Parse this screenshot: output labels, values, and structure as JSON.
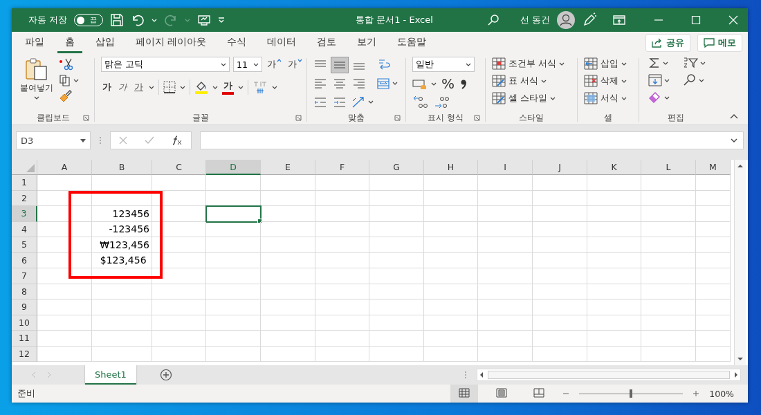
{
  "title_bar": {
    "autosave_label": "자동 저장",
    "autosave_toggle": {
      "label": "끔",
      "on": false
    },
    "redo_disabled": true,
    "document_title": "통합 문서1  -  Excel",
    "user_name": "선 동건"
  },
  "ribbon_tabs": [
    {
      "label": "파일",
      "selected": false
    },
    {
      "label": "홈",
      "selected": true
    },
    {
      "label": "삽입",
      "selected": false
    },
    {
      "label": "페이지 레이아웃",
      "selected": false
    },
    {
      "label": "수식",
      "selected": false
    },
    {
      "label": "데이터",
      "selected": false
    },
    {
      "label": "검토",
      "selected": false
    },
    {
      "label": "보기",
      "selected": false
    },
    {
      "label": "도움말",
      "selected": false
    }
  ],
  "share_button": "공유",
  "comments_button": "메모",
  "clipboard": {
    "paste": "붙여넣기",
    "label": "클립보드"
  },
  "font": {
    "font_name": "맑은 고딕",
    "font_size": "11",
    "grow": "가",
    "shrink": "가",
    "bold": "가",
    "italic": "가",
    "underline": "가",
    "font_color": "가",
    "label": "글꼴"
  },
  "alignment": {
    "vertical_align": [
      {
        "selected": false
      },
      {
        "selected": true
      },
      {
        "selected": false
      }
    ],
    "label": "맞춤"
  },
  "number": {
    "format": "일반",
    "percent": "%",
    "label": "표시 형식"
  },
  "styles": {
    "items": [
      "조건부 서식",
      "표 서식",
      "셀 스타일"
    ],
    "label": "스타일"
  },
  "cells": {
    "items": [
      "삽입",
      "삭제",
      "서식"
    ],
    "label": "셀"
  },
  "editing": {
    "label": "편집"
  },
  "formula_bar": {
    "name_box": "D3"
  },
  "columns": [
    {
      "label": "A",
      "selected": false
    },
    {
      "label": "B",
      "selected": false
    },
    {
      "label": "C",
      "selected": false
    },
    {
      "label": "D",
      "selected": true
    },
    {
      "label": "E",
      "selected": false
    },
    {
      "label": "F",
      "selected": false
    },
    {
      "label": "G",
      "selected": false
    },
    {
      "label": "H",
      "selected": false
    },
    {
      "label": "I",
      "selected": false
    },
    {
      "label": "J",
      "selected": false
    },
    {
      "label": "K",
      "selected": false
    },
    {
      "label": "L",
      "selected": false
    },
    {
      "label": "M",
      "selected": false
    }
  ],
  "rows": [
    {
      "label": "1",
      "selected": false
    },
    {
      "label": "2",
      "selected": false
    },
    {
      "label": "3",
      "selected": true,
      "cells": [
        null,
        "123456"
      ]
    },
    {
      "label": "4",
      "selected": false,
      "cells": [
        null,
        "-123456"
      ]
    },
    {
      "label": "5",
      "selected": false,
      "cells": [
        null,
        "₩123,456"
      ]
    },
    {
      "label": "6",
      "selected": false,
      "cells": [
        null,
        "$123,456 "
      ]
    },
    {
      "label": "7",
      "selected": false
    },
    {
      "label": "8",
      "selected": false
    },
    {
      "label": "9",
      "selected": false
    },
    {
      "label": "10",
      "selected": false
    },
    {
      "label": "11",
      "selected": false
    },
    {
      "label": "12",
      "selected": false
    }
  ],
  "sheet_tabs": [
    {
      "label": "Sheet1",
      "selected": true
    }
  ],
  "status_bar": {
    "status": "준비",
    "views": [
      {
        "kind": "normal",
        "selected": true
      },
      {
        "kind": "page_layout",
        "selected": false
      },
      {
        "kind": "page_break",
        "selected": false
      }
    ],
    "zoom": {
      "level": 0.5
    },
    "zoom_label": "100%"
  }
}
